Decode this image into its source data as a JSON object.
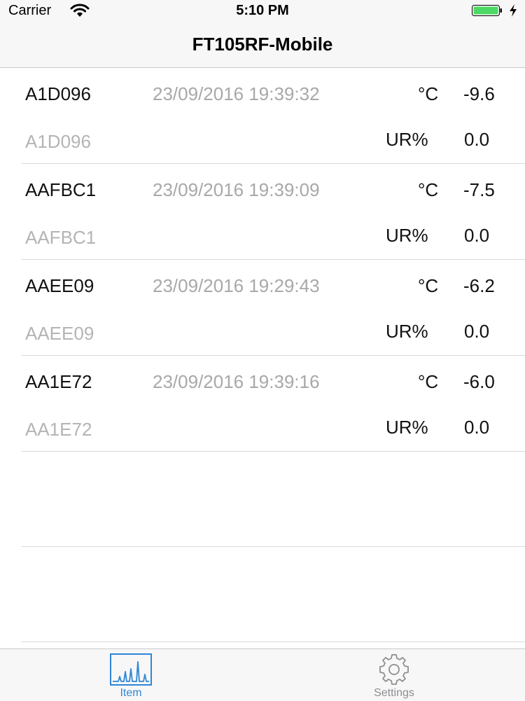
{
  "status_bar": {
    "carrier": "Carrier",
    "time": "5:10 PM",
    "icons": [
      "wifi-icon",
      "battery-icon",
      "charging-bolt-icon"
    ],
    "battery_color": "#4cd964"
  },
  "nav": {
    "title": "FT105RF-Mobile"
  },
  "sensors": [
    {
      "id": "A1D096",
      "timestamp": "23/09/2016 19:39:32",
      "temp_unit": "°C",
      "temp": "-9.6",
      "sub_id": "A1D096",
      "hum_unit": "UR%",
      "hum": "0.0"
    },
    {
      "id": "AAFBC1",
      "timestamp": "23/09/2016 19:39:09",
      "temp_unit": "°C",
      "temp": "-7.5",
      "sub_id": "AAFBC1",
      "hum_unit": "UR%",
      "hum": "0.0"
    },
    {
      "id": "AAEE09",
      "timestamp": "23/09/2016 19:29:43",
      "temp_unit": "°C",
      "temp": "-6.2",
      "sub_id": "AAEE09",
      "hum_unit": "UR%",
      "hum": "0.0"
    },
    {
      "id": "AA1E72",
      "timestamp": "23/09/2016 19:39:16",
      "temp_unit": "°C",
      "temp": "-6.0",
      "sub_id": "AA1E72",
      "hum_unit": "UR%",
      "hum": "0.0"
    }
  ],
  "tabs": [
    {
      "label": "Item",
      "icon": "chart-icon",
      "active": true,
      "color": "#2f86d6"
    },
    {
      "label": "Settings",
      "icon": "gear-icon",
      "active": false,
      "color": "#8e8e93"
    }
  ]
}
